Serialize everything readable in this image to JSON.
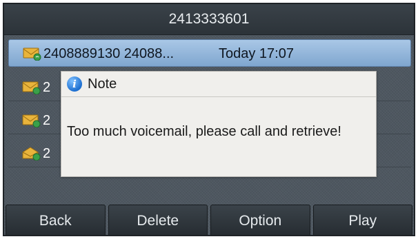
{
  "header": {
    "title": "2413333601"
  },
  "voicemail_list": {
    "items": [
      {
        "icon": "voicemail-envelope-icon",
        "text": "2408889130 24088...",
        "time": "Today 17:07",
        "selected": true
      },
      {
        "icon": "voicemail-envelope-icon",
        "text": "2",
        "time": "",
        "selected": false
      },
      {
        "icon": "voicemail-envelope-icon",
        "text": "2",
        "time": "",
        "selected": false
      },
      {
        "icon": "voicemail-envelope-open-icon",
        "text": "2",
        "time": "",
        "selected": false
      }
    ]
  },
  "dialog": {
    "icon": "info-icon",
    "title": "Note",
    "message": "Too much voicemail, please call and retrieve!"
  },
  "softkeys": [
    {
      "label": "Back"
    },
    {
      "label": "Delete"
    },
    {
      "label": "Option"
    },
    {
      "label": "Play"
    }
  ],
  "colors": {
    "screen_bg": "#4e5760",
    "selected_row": "#7fa6cf",
    "dialog_bg": "#f0efec",
    "info_icon": "#1d6fd0",
    "envelope": "#e9b43c"
  }
}
